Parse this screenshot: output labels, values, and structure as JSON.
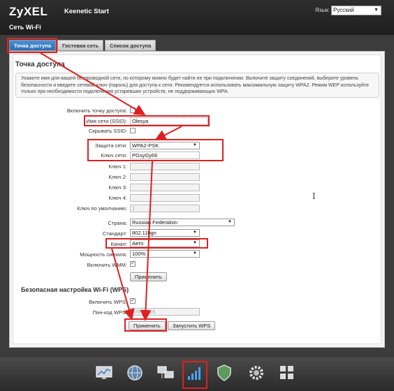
{
  "header": {
    "logo": "ZyXEL",
    "product": "Keenetic Start",
    "lang_label": "Язык:",
    "lang_value": "Русский",
    "section_title": "Сеть Wi-Fi"
  },
  "tabs": [
    {
      "label": "Точка доступа",
      "active": true
    },
    {
      "label": "Гостевая сеть",
      "active": false
    },
    {
      "label": "Список доступа",
      "active": false
    }
  ],
  "panel": {
    "heading": "Точка доступа",
    "info": "Укажите имя для вашей беспроводной сети, по которому можно будет найти ее при подключении. Включите защиту соединений, выберите уровень безопасности и введите сетевой ключ (пароль) для доступа к сети. Рекомендуется использовать максимальную защиту WPA2. Режим WEP используйте только при необходимости подключения устаревших устройств, не поддерживающих WPA."
  },
  "form": {
    "enable_ap_label": "Включить точку доступа:",
    "ssid_label": "Имя сети (SSID):",
    "ssid_value": "Olesya",
    "hide_ssid_label": "Скрывать SSID:",
    "security_label": "Защита сети:",
    "security_value": "WPA2-PSK",
    "key_label": "Ключ сети:",
    "key_value": "PGsyGy66",
    "key1_label": "Ключ 1:",
    "key2_label": "Ключ 2:",
    "key3_label": "Ключ 3:",
    "key4_label": "Ключ 4:",
    "default_key_label": "Ключ по умолчанию:",
    "default_key_value": "1",
    "country_label": "Страна:",
    "country_value": "Russian Federation",
    "standard_label": "Стандарт:",
    "standard_value": "802.11bgn",
    "channel_label": "Канал:",
    "channel_value": "Авто",
    "power_label": "Мощность сигнала:",
    "power_value": "100%",
    "wmm_label": "Включить WMM:",
    "apply_label": "Применить"
  },
  "wps": {
    "heading": "Безопасная настройка Wi-Fi (WPS)",
    "enable_label": "Включить WPS:",
    "pin_label": "Пин-код WPS:",
    "pin_value": "37870926",
    "apply_label": "Применить",
    "start_label": "Запустить WPS"
  },
  "dock": {
    "items": [
      {
        "icon": "monitor-chart-icon"
      },
      {
        "icon": "globe-icon"
      },
      {
        "icon": "network-computers-icon"
      },
      {
        "icon": "wifi-signal-icon",
        "active": true
      },
      {
        "icon": "shield-icon"
      },
      {
        "icon": "gear-icon"
      },
      {
        "icon": "apps-grid-icon"
      }
    ]
  },
  "colors": {
    "annotation": "#e02020",
    "tab_active": "#2c6fb5",
    "header_bg": "#1e1e1e"
  }
}
